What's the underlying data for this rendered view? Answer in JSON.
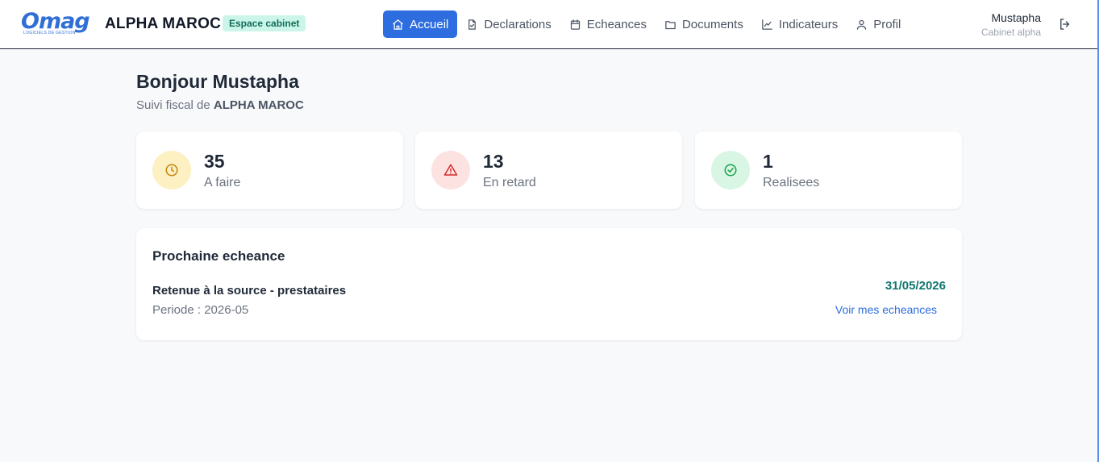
{
  "header": {
    "logo_text": "Omag",
    "logo_subtext": "LOGICIELS DE GESTION",
    "company": "ALPHA MAROC",
    "badge": "Espace cabinet",
    "nav": [
      {
        "label": "Accueil",
        "icon": "home-icon",
        "active": true
      },
      {
        "label": "Declarations",
        "icon": "file-check-icon",
        "active": false
      },
      {
        "label": "Echeances",
        "icon": "calendar-icon",
        "active": false
      },
      {
        "label": "Documents",
        "icon": "folder-icon",
        "active": false
      },
      {
        "label": "Indicateurs",
        "icon": "chart-line-icon",
        "active": false
      },
      {
        "label": "Profil",
        "icon": "user-icon",
        "active": false
      }
    ],
    "user": {
      "name": "Mustapha",
      "cabinet": "Cabinet alpha"
    },
    "logout_icon": "logout-icon"
  },
  "main": {
    "greeting": "Bonjour Mustapha",
    "subtitle_prefix": "Suivi fiscal de ",
    "subtitle_company": "ALPHA MAROC",
    "stats": [
      {
        "value": "35",
        "label": "A faire",
        "icon": "clock-icon",
        "bg": "#fdf0c2",
        "fg": "#c2850c"
      },
      {
        "value": "13",
        "label": "En retard",
        "icon": "warning-icon",
        "bg": "#fde2e2",
        "fg": "#d42a2a"
      },
      {
        "value": "1",
        "label": "Realisees",
        "icon": "check-circle-icon",
        "bg": "#d8f6e3",
        "fg": "#16a34a"
      }
    ],
    "next_due": {
      "title": "Prochaine echeance",
      "item": "Retenue à la source - prestataires",
      "period": "Periode : 2026-05",
      "date": "31/05/2026",
      "link": "Voir mes echeances"
    }
  },
  "colors": {
    "accent": "#2d6de0",
    "badge_bg": "#ccf5ea",
    "date_color": "#0f766e"
  }
}
